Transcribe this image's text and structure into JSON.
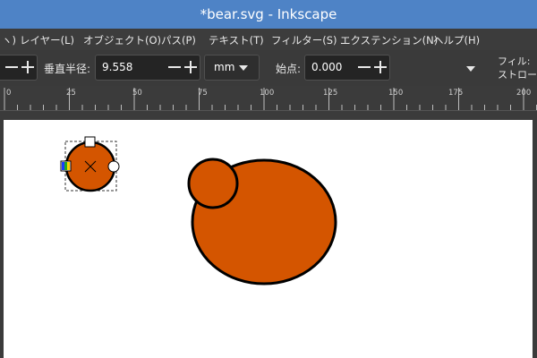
{
  "window": {
    "title": "*bear.svg - Inkscape"
  },
  "menu": {
    "items": [
      "ヽ)",
      "レイヤー(L)",
      "オブジェクト(O)",
      "パス(P)",
      "テキスト(T)",
      "フィルター(S)",
      "エクステンション(N)",
      "ヘルプ(H)"
    ]
  },
  "toolbar": {
    "radius_label": "垂直半径:",
    "radius_value": "9.558",
    "unit": "mm",
    "start_label": "始点:",
    "start_value": "0.000",
    "fill_label": "フィル:",
    "stroke_label": "ストローク:"
  },
  "ruler": {
    "labels": [
      "0",
      "25",
      "50",
      "75",
      "100",
      "125",
      "150",
      "175",
      "200"
    ]
  },
  "canvas": {
    "fill_color": "#d45500",
    "stroke_color": "#000000",
    "page_color": "#ffffff"
  }
}
